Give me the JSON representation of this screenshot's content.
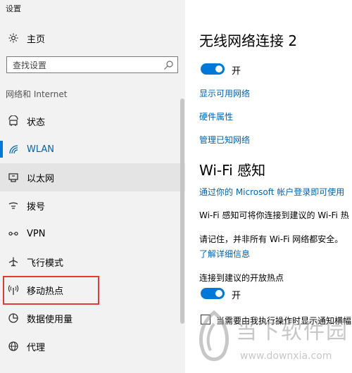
{
  "window": {
    "title": "设置"
  },
  "sidebar": {
    "home_label": "主页",
    "search": {
      "placeholder": "查找设置"
    },
    "section_label": "网络和 Internet",
    "items": [
      {
        "label": "状态",
        "icon": "status-icon"
      },
      {
        "label": "WLAN",
        "icon": "wifi-icon",
        "selected": true
      },
      {
        "label": "以太网",
        "icon": "ethernet-icon"
      },
      {
        "label": "拨号",
        "icon": "dialup-icon"
      },
      {
        "label": "VPN",
        "icon": "vpn-icon"
      },
      {
        "label": "飞行模式",
        "icon": "airplane-icon"
      },
      {
        "label": "移动热点",
        "icon": "hotspot-icon",
        "highlighted": true
      },
      {
        "label": "数据使用量",
        "icon": "data-usage-icon"
      },
      {
        "label": "代理",
        "icon": "globe-icon"
      }
    ]
  },
  "main": {
    "title": "无线网络连接 2",
    "toggle_state": "开",
    "links": [
      "显示可用网络",
      "硬件属性",
      "管理已知网络"
    ],
    "wifi_sense": {
      "heading": "Wi-Fi 感知",
      "login_link": "通过你的 Microsoft 帐户登录即可使用",
      "desc1": "Wi-Fi 感知可将你连接到建议的 Wi-Fi 热",
      "desc2": "请记住，并非所有 Wi-Fi 网络都安全。",
      "learn_more": "了解详细信息",
      "open_hotspot_label": "连接到建议的开放热点",
      "open_hotspot_state": "开",
      "checkbox_label": "当需要由我执行操作时显示通知横幅"
    }
  },
  "watermark": {
    "name": "当下软件园",
    "url": "www.downxia.com"
  },
  "colors": {
    "accent": "#0078d7",
    "link": "#0063b1",
    "highlight_box": "#e03a3a"
  }
}
